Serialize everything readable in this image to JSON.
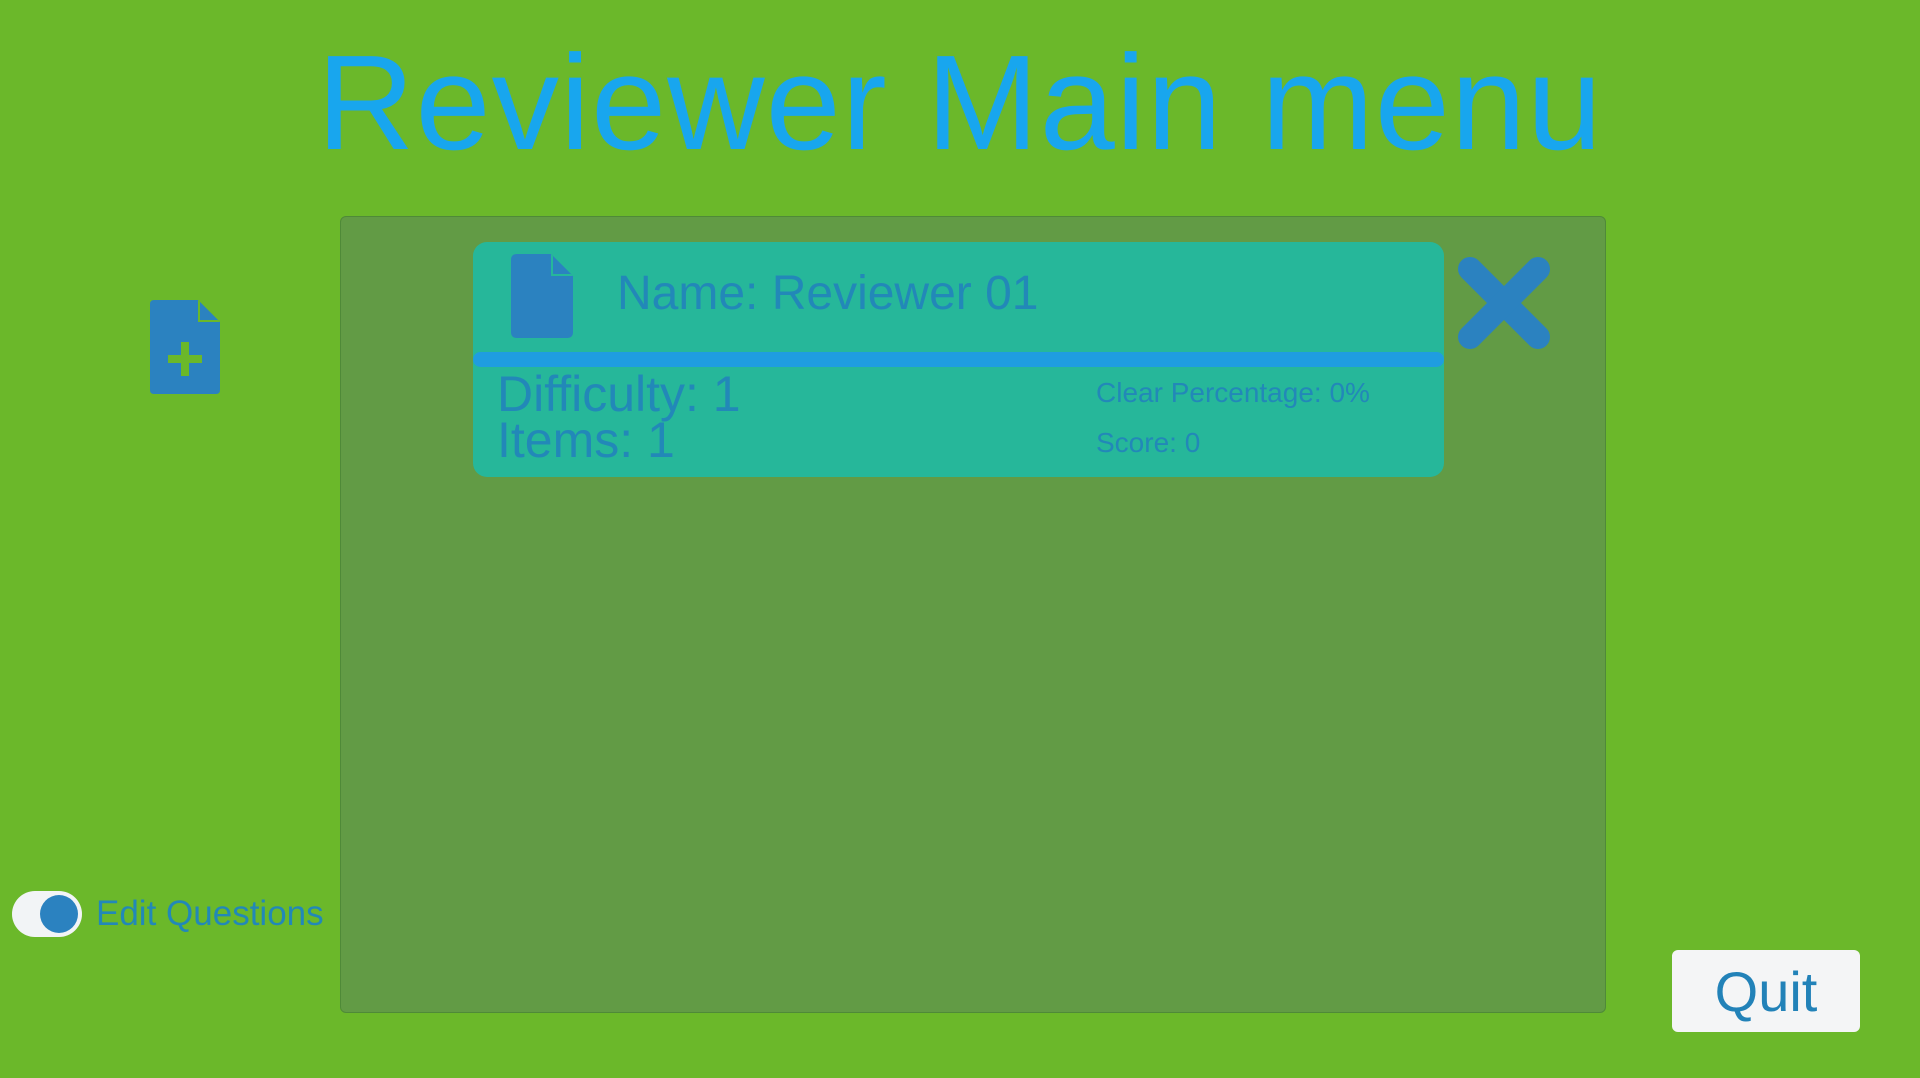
{
  "header": {
    "title": "Reviewer Main menu"
  },
  "sidebar": {
    "add_icon": "file-plus-icon"
  },
  "reviewer_list": {
    "items": [
      {
        "name_text": "Name: Reviewer 01",
        "difficulty_text": "Difficulty: 1",
        "items_text": "Items: 1",
        "clear_text": "Clear Percentage: 0%",
        "score_text": "Score: 0",
        "icon": "file-icon",
        "delete_icon": "close-icon"
      }
    ]
  },
  "edit_toggle": {
    "label": "Edit Questions",
    "on": true
  },
  "footer": {
    "quit_label": "Quit"
  },
  "colors": {
    "background": "#6bb82a",
    "title": "#18a6ee",
    "panel": "#629b45",
    "card": "#26b79a",
    "divider": "#1f9de0",
    "text": "#2288b8",
    "icon": "#2b82c0"
  }
}
